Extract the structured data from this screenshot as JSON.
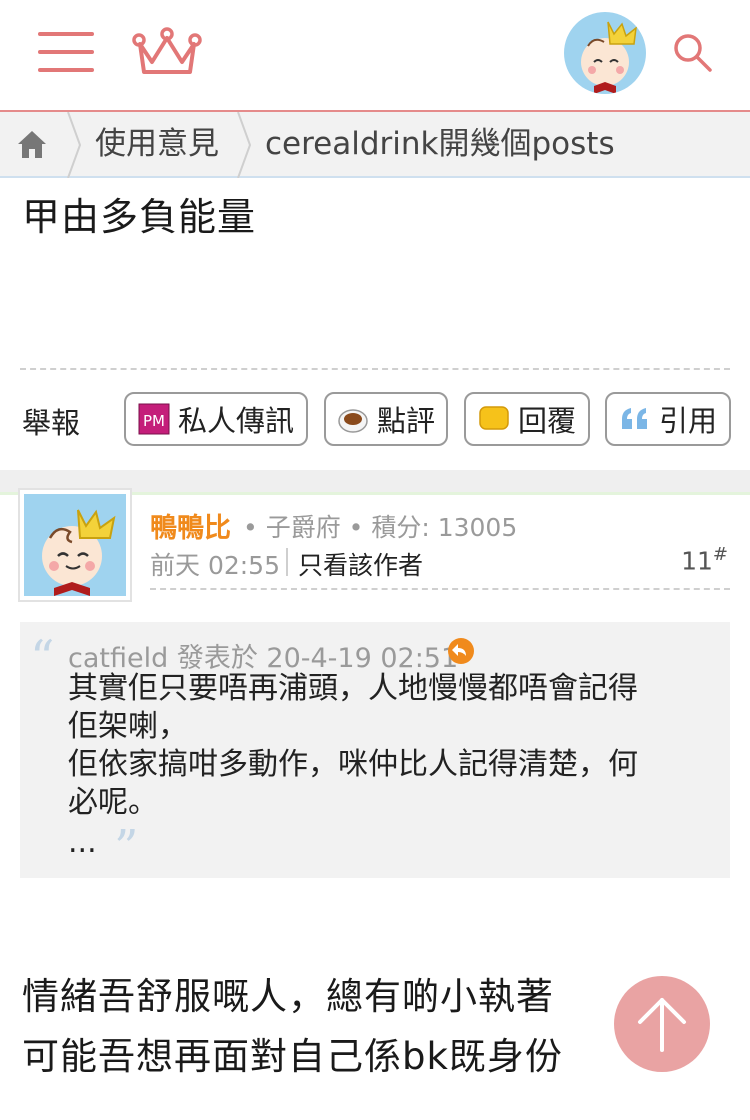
{
  "header": {
    "menu_icon": "hamburger-menu-icon",
    "crown_icon": "crown-icon",
    "avatar": "user-avatar",
    "search_icon": "search-icon",
    "accent_color": "#e27777"
  },
  "breadcrumb": {
    "home_icon": "home-icon",
    "items": [
      "使用意見",
      "cerealdrink開幾個posts"
    ]
  },
  "previous_post": {
    "text": "甲由多負能量",
    "report_label": "舉報",
    "actions": [
      {
        "label": "私人傳訊",
        "icon": "pm-icon"
      },
      {
        "label": "點評",
        "icon": "coffee-cup-icon"
      },
      {
        "label": "回覆",
        "icon": "speech-bubble-icon"
      },
      {
        "label": "引用",
        "icon": "quote-icon"
      }
    ]
  },
  "post": {
    "author": "鴨鴨比",
    "meta": "• 子爵府 • 積分: 13005",
    "time": "前天 02:55",
    "only_author_label": "只看該作者",
    "floor": "11",
    "floor_suffix": "#",
    "quote": {
      "author_line": "catfield 發表於 20-4-19 02:51",
      "lines": [
        "其實佢只要唔再浦頭，人地慢慢都唔會記得",
        "佢架喇，",
        "佢依家搞咁多動作，咪仲比人記得清楚，何",
        "必呢。",
        "..."
      ]
    },
    "content_lines": [
      "情緒吾舒服嘅人，總有啲小執著",
      "可能吾想再面對自己係bk既身份"
    ]
  },
  "colors": {
    "author_name": "#f08a1c",
    "scroll_top_button": "#e9a3a3",
    "quote_mark": "#c4d6e6"
  }
}
